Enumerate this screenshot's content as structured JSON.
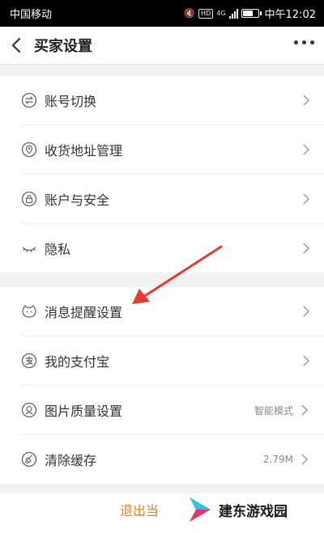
{
  "status_bar": {
    "carrier": "中国移动",
    "time": "中午12:02",
    "network": "4G"
  },
  "nav": {
    "title": "买家设置"
  },
  "group1": [
    {
      "label": "账号切换",
      "icon": "swap-icon"
    },
    {
      "label": "收货地址管理",
      "icon": "location-icon"
    },
    {
      "label": "账户与安全",
      "icon": "lock-icon"
    },
    {
      "label": "隐私",
      "icon": "eye-icon"
    }
  ],
  "group2": [
    {
      "label": "消息提醒设置",
      "icon": "bell-icon",
      "value": ""
    },
    {
      "label": "我的支付宝",
      "icon": "alipay-icon",
      "value": ""
    },
    {
      "label": "图片质量设置",
      "icon": "image-icon",
      "value": "智能模式"
    },
    {
      "label": "清除缓存",
      "icon": "broom-icon",
      "value": "2.79M"
    }
  ],
  "footer": {
    "logout_label": "退出当"
  },
  "watermark": {
    "text": "建东游戏园"
  },
  "colors": {
    "accent": "#f57c1b",
    "annotation_arrow": "#e53935"
  }
}
